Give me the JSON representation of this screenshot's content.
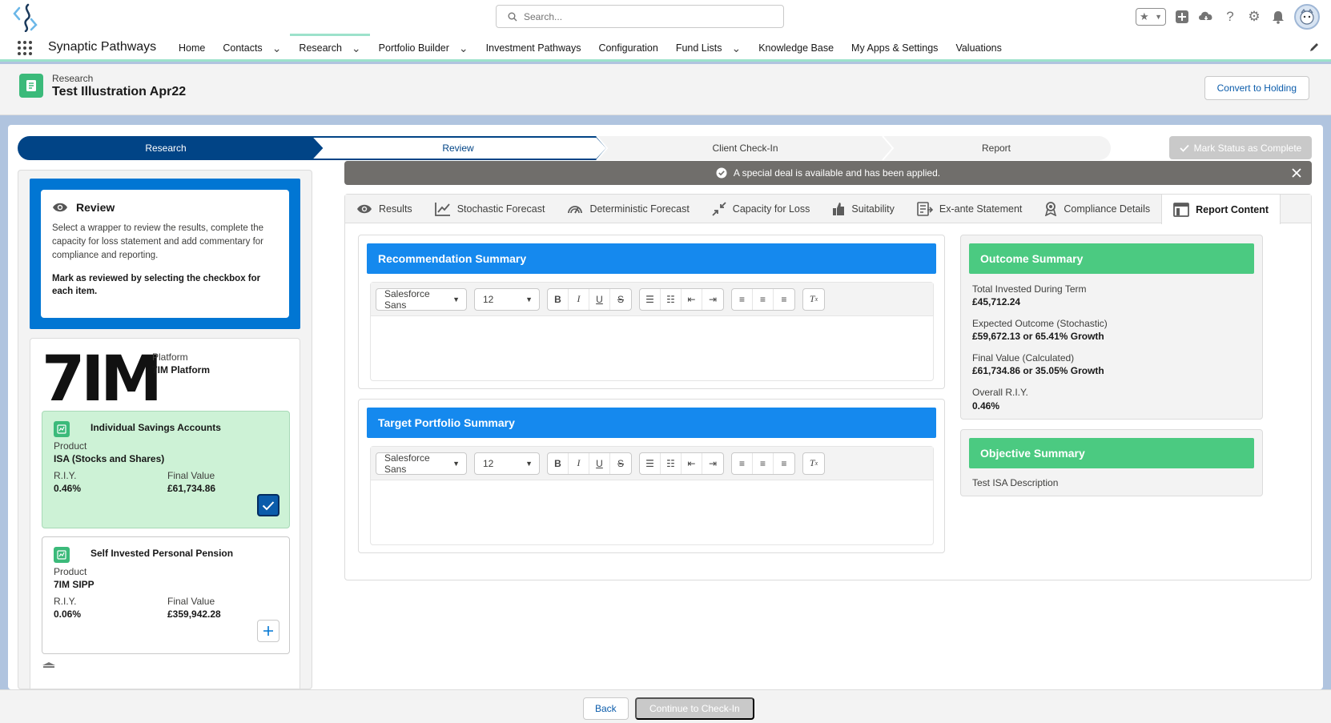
{
  "header": {
    "search_placeholder": "Search...",
    "icons": [
      "favorites-star-icon",
      "favorites-dropdown-icon",
      "add-icon",
      "trailhead-icon",
      "help-icon",
      "setup-gear-icon",
      "notifications-bell-icon",
      "user-avatar"
    ]
  },
  "nav": {
    "app_name": "Synaptic Pathways",
    "items": [
      {
        "label": "Home",
        "chevron": false,
        "active": false
      },
      {
        "label": "Contacts",
        "chevron": true,
        "active": false
      },
      {
        "label": "Research",
        "chevron": true,
        "active": true
      },
      {
        "label": "Portfolio Builder",
        "chevron": true,
        "active": false
      },
      {
        "label": "Investment Pathways",
        "chevron": false,
        "active": false
      },
      {
        "label": "Configuration",
        "chevron": false,
        "active": false
      },
      {
        "label": "Fund Lists",
        "chevron": true,
        "active": false
      },
      {
        "label": "Knowledge Base",
        "chevron": false,
        "active": false
      },
      {
        "label": "My Apps & Settings",
        "chevron": false,
        "active": false
      },
      {
        "label": "Valuations",
        "chevron": false,
        "active": false
      }
    ]
  },
  "record": {
    "object_label": "Research",
    "title": "Test Illustration Apr22",
    "convert_label": "Convert to Holding"
  },
  "path": {
    "steps": [
      {
        "label": "Research",
        "state": "complete"
      },
      {
        "label": "Review",
        "state": "current"
      },
      {
        "label": "Client Check-In",
        "state": "incomplete"
      },
      {
        "label": "Report",
        "state": "incomplete"
      }
    ],
    "mark_complete_label": "Mark Status as Complete"
  },
  "review": {
    "title": "Review",
    "description": "Select a wrapper to review the results, complete the capacity for loss statement and add commentary for compliance and reporting.",
    "instruction": "Mark as reviewed by selecting the checkbox for each item."
  },
  "platform": {
    "brand": "7IM",
    "label": "Platform",
    "value": "7IM Platform",
    "products": [
      {
        "name": "Individual Savings Accounts",
        "product_label": "Product",
        "product_value": "ISA (Stocks and Shares)",
        "riy_label": "R.I.Y.",
        "riy_value": "0.46%",
        "final_label": "Final Value",
        "final_value": "£61,734.86",
        "reviewed": true
      },
      {
        "name": "Self Invested Personal Pension",
        "product_label": "Product",
        "product_value": "7IM SIPP",
        "riy_label": "R.I.Y.",
        "riy_value": "0.06%",
        "final_label": "Final Value",
        "final_value": "£359,942.28",
        "reviewed": false
      }
    ]
  },
  "toast": {
    "message": "A special deal is available and has been applied."
  },
  "tabs": [
    {
      "label": "Results",
      "icon": "eye-icon",
      "active": false
    },
    {
      "label": "Stochastic Forecast",
      "icon": "line-chart-icon",
      "active": false
    },
    {
      "label": "Deterministic Forecast",
      "icon": "gauge-icon",
      "active": false
    },
    {
      "label": "Capacity for Loss",
      "icon": "contract-arrows-icon",
      "active": false
    },
    {
      "label": "Suitability",
      "icon": "thumbs-up-icon",
      "active": false
    },
    {
      "label": "Ex-ante Statement",
      "icon": "statement-icon",
      "active": false
    },
    {
      "label": "Compliance Details",
      "icon": "ribbon-icon",
      "active": false
    },
    {
      "label": "Report Content",
      "icon": "layout-icon",
      "active": true
    }
  ],
  "editors": {
    "font_family": "Salesforce Sans",
    "font_size": "12",
    "recommendation_title": "Recommendation Summary",
    "target_title": "Target Portfolio Summary"
  },
  "outcome": {
    "title": "Outcome Summary",
    "items": [
      {
        "label": "Total Invested During Term",
        "value": "£45,712.24"
      },
      {
        "label": "Expected Outcome (Stochastic)",
        "value": "£59,672.13 or 65.41% Growth"
      },
      {
        "label": "Final Value (Calculated)",
        "value": "£61,734.86 or 35.05% Growth"
      },
      {
        "label": "Overall R.I.Y.",
        "value": "0.46%"
      }
    ]
  },
  "objective": {
    "title": "Objective Summary",
    "text": "Test ISA Description"
  },
  "footer": {
    "back_label": "Back",
    "continue_label": "Continue to Check-In"
  },
  "colors": {
    "brand_blue": "#0176d3",
    "path_complete": "#014486",
    "header_blue": "#1589ee",
    "header_green": "#4bca81",
    "selected_card": "#cdf2d6"
  }
}
